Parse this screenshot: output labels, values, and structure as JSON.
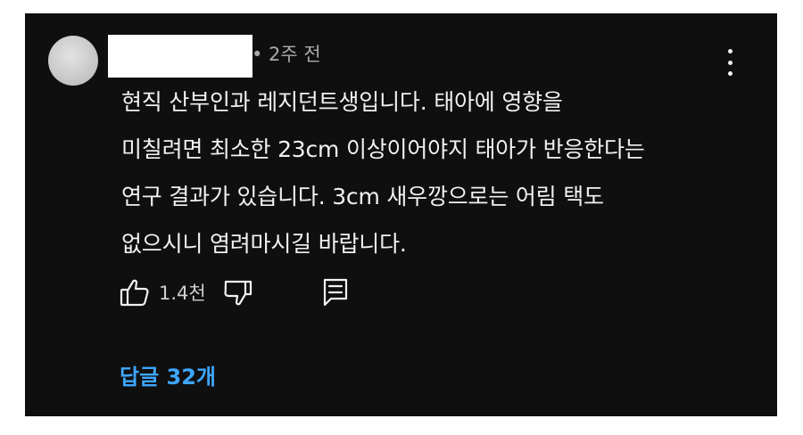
{
  "comment": {
    "time": "• 2주 전",
    "text_lines": [
      "현직 산부인과 레지던트생입니다. 태아에 영향을",
      "미칠려면 최소한 23cm 이상이어야지 태아가 반응한다는",
      "연구 결과가 있습니다. 3cm 새우깡으로는 어림 택도",
      "없으시니 염려마시길 바랍니다."
    ],
    "like_count": "1.4천",
    "replies_label": "답글 32개"
  },
  "icons": {
    "like": "thumb-up-icon",
    "dislike": "thumb-down-icon",
    "reply": "comment-icon",
    "more": "more-vertical-icon"
  },
  "colors": {
    "background": "#0f0f0f",
    "text": "#f1f1f1",
    "secondary_text": "#aaaaaa",
    "link": "#3ea6ff"
  }
}
